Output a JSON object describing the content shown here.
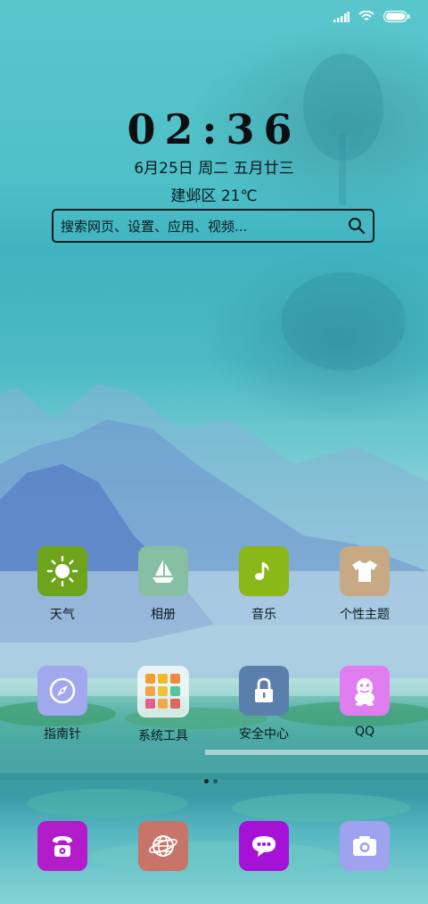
{
  "status_bar": {
    "signal_icon": "signal-icon",
    "wifi_icon": "wifi-icon",
    "battery_icon": "battery-icon"
  },
  "clock": {
    "time": "02:36"
  },
  "date": {
    "text": "6月25日 周二 五月廿三"
  },
  "weather": {
    "text": "建邺区 21℃"
  },
  "search": {
    "placeholder": "搜索网页、设置、应用、视频..."
  },
  "apps_row1": [
    {
      "label": "天气",
      "icon": "sun-icon",
      "color": "#6ea31c"
    },
    {
      "label": "相册",
      "icon": "sailboat-icon",
      "color": "#86bfa3"
    },
    {
      "label": "音乐",
      "icon": "music-note-icon",
      "color": "#89b818"
    },
    {
      "label": "个性主题",
      "icon": "tshirt-icon",
      "color": "#c7a984"
    }
  ],
  "apps_row2": [
    {
      "label": "指南针",
      "icon": "compass-icon",
      "color": "#a1a8ee"
    },
    {
      "label": "系统工具",
      "icon": "folder-icon",
      "color": "#ffffff"
    },
    {
      "label": "安全中心",
      "icon": "lock-icon",
      "color": "#5b7fad"
    },
    {
      "label": "QQ",
      "icon": "qq-penguin-icon",
      "color": "#e07ef0"
    }
  ],
  "page_indicator": {
    "pages": 2,
    "current": 1
  },
  "dock": [
    {
      "icon": "phone-icon",
      "color": "#b21cc9"
    },
    {
      "icon": "browser-globe-icon",
      "color": "#c87468"
    },
    {
      "icon": "message-icon",
      "color": "#a611d8"
    },
    {
      "icon": "camera-icon",
      "color": "#9fa3ef"
    }
  ]
}
